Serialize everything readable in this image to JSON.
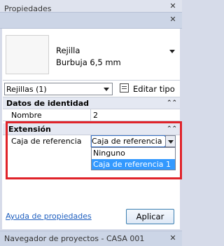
{
  "panel": {
    "title": "Propiedades"
  },
  "type_selector": {
    "family": "Rejilla",
    "type": "Burbuja 6,5 mm"
  },
  "instance_filter": {
    "value": "Rejillas (1)"
  },
  "edit_type": {
    "label": "Editar tipo"
  },
  "groups": [
    {
      "label": "Datos de identidad",
      "collapse_icon": "chevron-double-up-icon",
      "rows": [
        {
          "label": "Nombre",
          "value": "2"
        }
      ]
    },
    {
      "label": "Extensión",
      "collapse_icon": "chevron-double-up-icon",
      "rows": [
        {
          "label": "Caja de referencia",
          "value": "Caja de referencia 1"
        }
      ]
    }
  ],
  "dropdown": {
    "options": [
      "Ninguno",
      "Caja de referencia 1"
    ],
    "selected": "Caja de referencia 1"
  },
  "footer": {
    "help_link": "Ayuda de propiedades",
    "apply_label": "Aplicar"
  },
  "navigator": {
    "title": "Navegador de proyectos - CASA 001"
  },
  "colors": {
    "highlight": "#e0232a",
    "selection": "#3399ff",
    "link": "#1f5fbf"
  }
}
